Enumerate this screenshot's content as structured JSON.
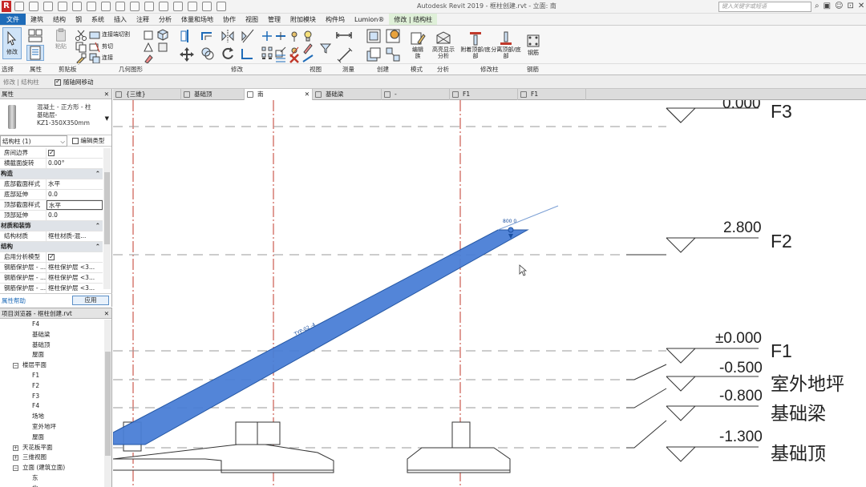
{
  "app": {
    "logo": "R",
    "window_title": "Autodesk Revit 2019 - 框柱创建.rvt - 立面: 南",
    "search_placeholder": "键入关键字或短语"
  },
  "menu": [
    {
      "label": "文件"
    },
    {
      "label": "建筑"
    },
    {
      "label": "结构"
    },
    {
      "label": "钢"
    },
    {
      "label": "系统"
    },
    {
      "label": "插入"
    },
    {
      "label": "注释"
    },
    {
      "label": "分析"
    },
    {
      "label": "体量和场地"
    },
    {
      "label": "协作"
    },
    {
      "label": "视图"
    },
    {
      "label": "管理"
    },
    {
      "label": "附加模块"
    },
    {
      "label": "构件坞"
    },
    {
      "label": "Lumion®"
    },
    {
      "label": "修改 | 结构柱"
    }
  ],
  "ribbon": {
    "modify_label": "修改",
    "properties_label": "属性",
    "paste_label": "粘贴",
    "cut_join_label": "连接端切割",
    "cut_label": "剪切",
    "join_label": "连接",
    "edit_family_label": "编辑族",
    "highlight_label": "高亮显示分析",
    "attach_label": "附着顶部/底部",
    "detach_label": "分离顶部/底部",
    "rebar_label": "钢筋",
    "panels": {
      "select": "选择",
      "properties": "属性",
      "clipboard": "剪贴板",
      "geometry": "几何图形",
      "modify": "修改",
      "view": "视图",
      "measure": "测量",
      "create": "创建",
      "mode": "模式",
      "analysis": "分析",
      "modify_column": "修改柱",
      "rebar": "钢筋"
    }
  },
  "options_bar": {
    "context": "修改 | 结构柱",
    "move_with_grid": "随轴网移动"
  },
  "properties": {
    "title": "属性",
    "type_name_1": "混凝土 - 正方形 - 柱",
    "type_name_2": "基础层-",
    "type_name_3": "KZ1-350X350mm",
    "instance_filter": "结构柱 (1)",
    "edit_type": "编辑类型",
    "rows": [
      {
        "k": "房间边界",
        "v": "",
        "check": true,
        "group": false
      },
      {
        "k": "横截面旋转",
        "v": "0.00°",
        "group": false
      },
      {
        "k": "构造",
        "v": "",
        "group": true
      },
      {
        "k": "底部截面样式",
        "v": "水平",
        "group": false
      },
      {
        "k": "底部延伸",
        "v": "0.0",
        "group": false
      },
      {
        "k": "顶部截面样式",
        "v": "水平",
        "group": false
      },
      {
        "k": "顶部延伸",
        "v": "0.0",
        "group": false
      },
      {
        "k": "材质和装饰",
        "v": "",
        "group": true
      },
      {
        "k": "结构材质",
        "v": "框柱材质-混...",
        "group": false
      },
      {
        "k": "结构",
        "v": "",
        "group": true
      },
      {
        "k": "启用分析模型",
        "v": "",
        "check": true,
        "group": false
      },
      {
        "k": "钢筋保护层 - ...",
        "v": "框柱保护层 <3...",
        "group": false
      },
      {
        "k": "钢筋保护层 - ...",
        "v": "框柱保护层 <3...",
        "group": false
      },
      {
        "k": "钢筋保护层 - ...",
        "v": "框柱保护层 <3...",
        "group": false
      }
    ],
    "help": "属性帮助",
    "apply": "应用"
  },
  "browser": {
    "title": "项目浏览器 - 框柱创建.rvt",
    "items": [
      {
        "label": "F4",
        "indent": 40,
        "toggle": ""
      },
      {
        "label": "基础梁",
        "indent": 40,
        "toggle": ""
      },
      {
        "label": "基础顶",
        "indent": 40,
        "toggle": ""
      },
      {
        "label": "屋面",
        "indent": 40,
        "toggle": ""
      },
      {
        "label": "楼层平面",
        "indent": 28,
        "toggle": "−"
      },
      {
        "label": "F1",
        "indent": 40,
        "toggle": ""
      },
      {
        "label": "F2",
        "indent": 40,
        "toggle": ""
      },
      {
        "label": "F3",
        "indent": 40,
        "toggle": ""
      },
      {
        "label": "F4",
        "indent": 40,
        "toggle": ""
      },
      {
        "label": "场地",
        "indent": 40,
        "toggle": ""
      },
      {
        "label": "室外地坪",
        "indent": 40,
        "toggle": ""
      },
      {
        "label": "屋面",
        "indent": 40,
        "toggle": ""
      },
      {
        "label": "天花板平面",
        "indent": 28,
        "toggle": "+"
      },
      {
        "label": "三维视图",
        "indent": 28,
        "toggle": "+"
      },
      {
        "label": "立面 (建筑立面)",
        "indent": 28,
        "toggle": "−"
      },
      {
        "label": "东",
        "indent": 40,
        "toggle": ""
      },
      {
        "label": "北",
        "indent": 40,
        "toggle": ""
      }
    ]
  },
  "tabs": [
    {
      "label": "{三维}",
      "active": false,
      "close": ""
    },
    {
      "label": "基础顶",
      "active": false,
      "close": ""
    },
    {
      "label": "南",
      "active": true,
      "close": "✕"
    },
    {
      "label": "基础梁",
      "active": false,
      "close": ""
    },
    {
      "label": "-",
      "active": false,
      "close": ""
    },
    {
      "label": "F1",
      "active": false,
      "close": ""
    },
    {
      "label": "F1",
      "active": false,
      "close": ""
    }
  ],
  "levels": [
    {
      "name": "F3",
      "elevation": "0.000"
    },
    {
      "name": "F2",
      "elevation": "2.800"
    },
    {
      "name": "F1",
      "elevation": "±0.000"
    },
    {
      "name": "室外地坪",
      "elevation": "-0.500"
    },
    {
      "name": "基础梁",
      "elevation": "-0.800"
    },
    {
      "name": "基础顶",
      "elevation": "-1.300"
    }
  ],
  "annotations": {
    "beam_tag": "TYP-02 -4",
    "control_label": "800 0"
  },
  "colors": {
    "accent": "#1e6bb8",
    "beam_fill": "#4a7fd6",
    "grid_red": "#c0392b",
    "level_line": "#7fa0c8"
  }
}
